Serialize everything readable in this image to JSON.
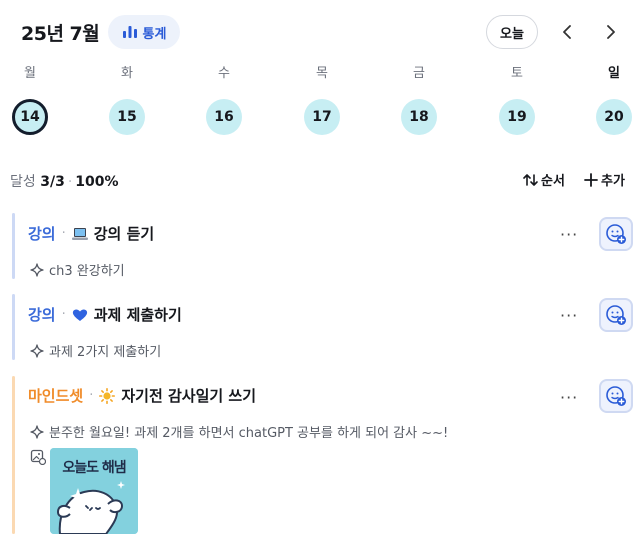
{
  "header": {
    "month_title": "25년 7월",
    "stats_label": "통계",
    "today_label": "오늘"
  },
  "week": {
    "days": [
      {
        "name": "월",
        "date": "14",
        "selected": true
      },
      {
        "name": "화",
        "date": "15",
        "selected": false
      },
      {
        "name": "수",
        "date": "16",
        "selected": false
      },
      {
        "name": "목",
        "date": "17",
        "selected": false
      },
      {
        "name": "금",
        "date": "18",
        "selected": false
      },
      {
        "name": "토",
        "date": "19",
        "selected": false
      },
      {
        "name": "일",
        "date": "20",
        "selected": false
      }
    ]
  },
  "summary": {
    "label": "달성",
    "count": "3/3",
    "percent": "100%",
    "order_label": "순서",
    "add_label": "추가"
  },
  "tasks": [
    {
      "category": "강의",
      "category_color": "#3b6bd9",
      "emoji": "laptop-icon",
      "name": "강의 듣기",
      "note": "ch3 완강하기"
    },
    {
      "category": "강의",
      "category_color": "#3b6bd9",
      "emoji": "blue-heart-icon",
      "name": "과제 제출하기",
      "note": "과제 2가지 제출하기"
    },
    {
      "category": "마인드셋",
      "category_color": "#f08c2a",
      "emoji": "sun-icon",
      "name": "자기전 감사일기 쓰기",
      "note": "분주한 월요일! 과제 2개를 하면서 chatGPT 공부를 하게 되어 감사 ~~!",
      "sticker_text": "오늘도 해냄"
    }
  ],
  "colors": {
    "accent_blue": "#2a5bd7",
    "day_circle": "#c7eef3",
    "lecture_bar": "#cdd9f5",
    "mindset_bar": "#fbd9b2"
  }
}
